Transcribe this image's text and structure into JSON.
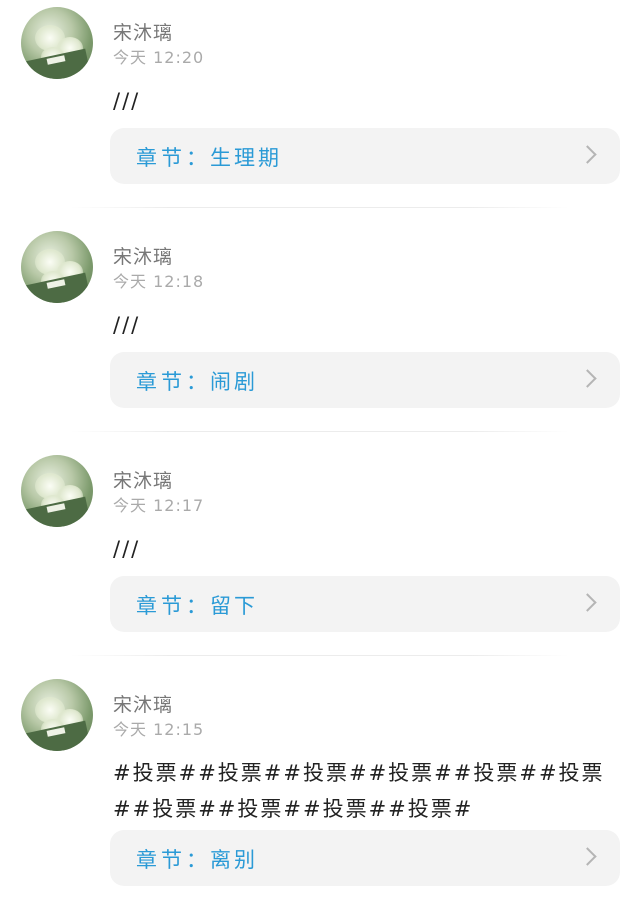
{
  "comments": [
    {
      "username": "宋沐璃",
      "timestamp": "今天 12:20",
      "text": "///",
      "chapter_label": "章节：",
      "chapter_name": "生理期"
    },
    {
      "username": "宋沐璃",
      "timestamp": "今天 12:18",
      "text": "///",
      "chapter_label": "章节：",
      "chapter_name": "闹剧"
    },
    {
      "username": "宋沐璃",
      "timestamp": "今天 12:17",
      "text": "///",
      "chapter_label": "章节：",
      "chapter_name": "留下"
    },
    {
      "username": "宋沐璃",
      "timestamp": "今天 12:15",
      "text": "#投票##投票##投票##投票##投票##投票##投票##投票##投票##投票#",
      "chapter_label": "章节：",
      "chapter_name": "离别"
    }
  ],
  "icons": {
    "avatar": "avatar-image",
    "chevron": "chevron-right-icon"
  }
}
